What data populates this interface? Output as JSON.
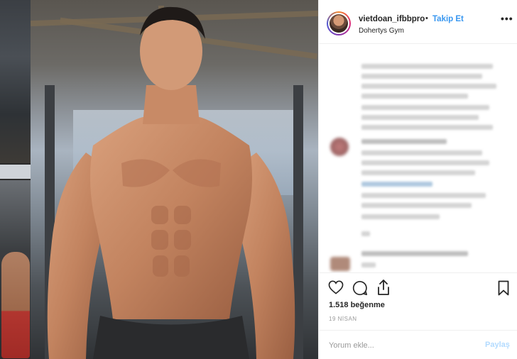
{
  "header": {
    "username": "vietdoan_ifbbpro",
    "separator": "•",
    "follow_label": "Takip Et",
    "location": "Dohertys Gym",
    "more_label": "•••"
  },
  "actions": {
    "like_icon": "heart-icon",
    "comment_icon": "comment-icon",
    "share_icon": "share-icon",
    "save_icon": "bookmark-icon",
    "likes_text": "1.518 beğenme",
    "date_text": "19 NİSAN"
  },
  "comment_box": {
    "placeholder": "Yorum ekle...",
    "post_label": "Paylaş"
  },
  "colors": {
    "accent": "#3897f0",
    "post_disabled": "#b3dbff",
    "text": "#262626",
    "muted": "#999999"
  }
}
